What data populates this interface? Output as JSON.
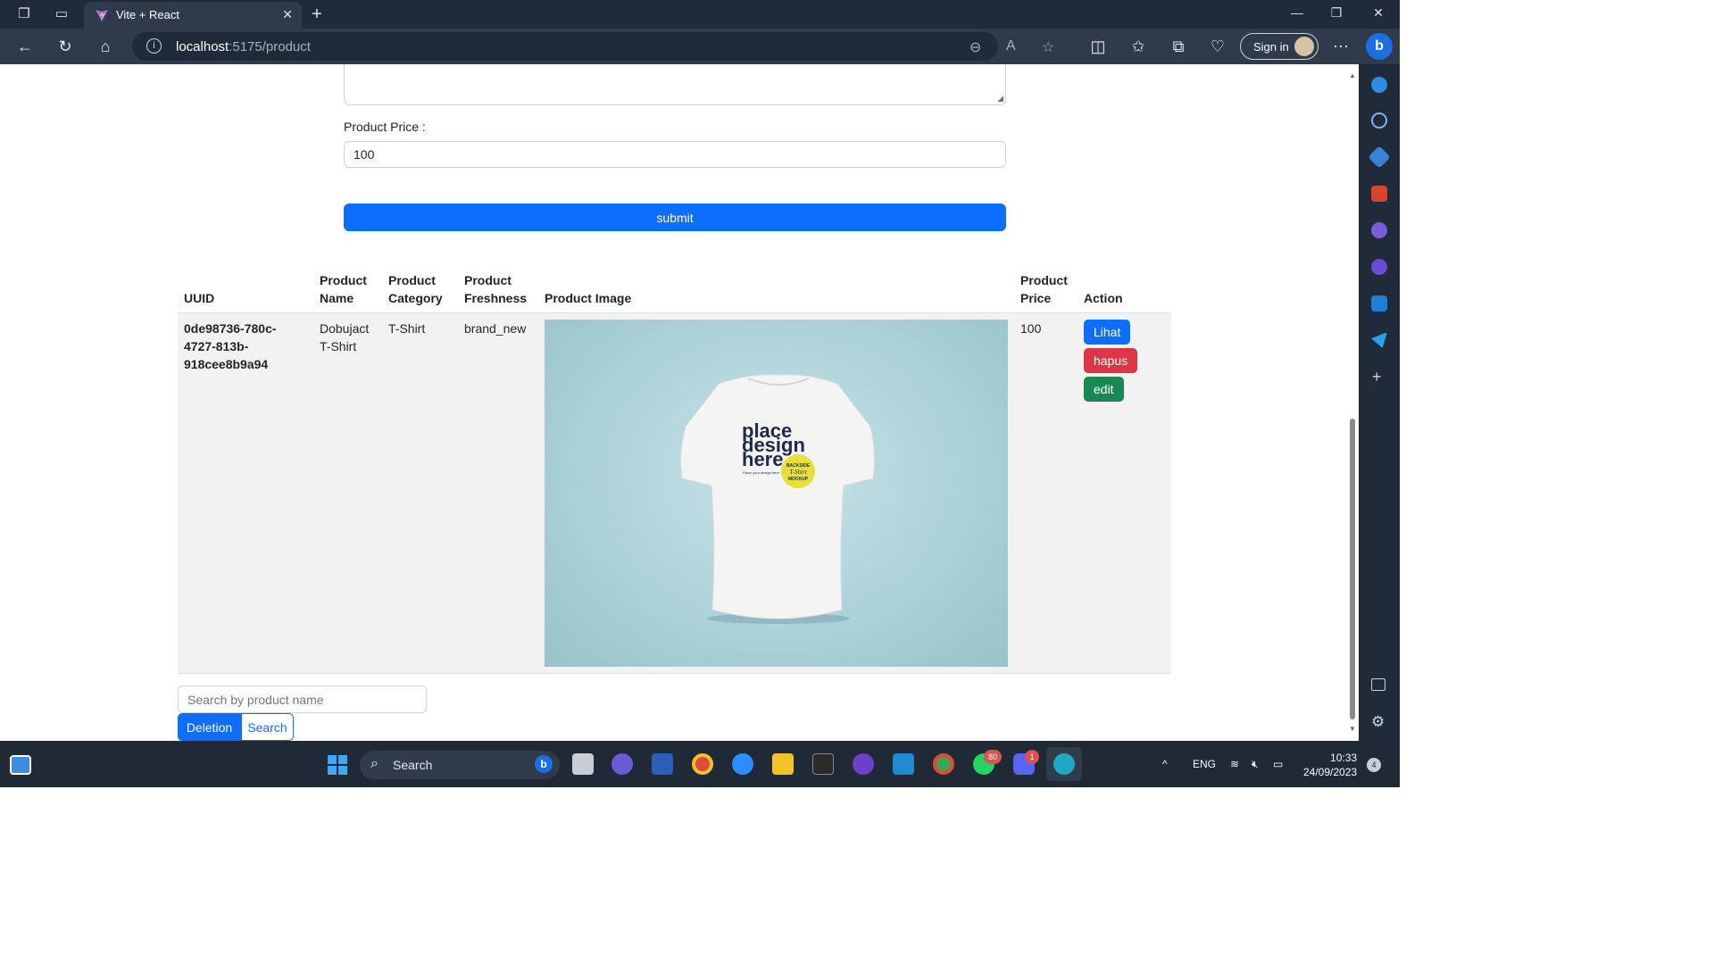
{
  "browser": {
    "tab_title": "Vite + React",
    "url_host": "localhost",
    "url_path": ":5175/product",
    "sign_in": "Sign in"
  },
  "form": {
    "price_label": "Product Price :",
    "price_value": "100",
    "submit_label": "submit"
  },
  "table": {
    "headers": {
      "uuid": "UUID",
      "name": "Product Name",
      "category": "Product Category",
      "freshness": "Product Freshness",
      "image": "Product Image",
      "price": "Product Price",
      "action": "Action"
    },
    "rows": [
      {
        "uuid": "0de98736-780c-4727-813b-918cee8b9a94",
        "name": "Dobujact T-Shirt",
        "category": "T-Shirt",
        "freshness": "brand_new",
        "image_text": "place design here",
        "image_small": "Place your design here",
        "sticker": "BACKSIDE T-Shirt MOCKUP",
        "price": "100",
        "actions": {
          "view": "Lihat",
          "delete": "hapus",
          "edit": "edit"
        }
      }
    ]
  },
  "search": {
    "placeholder": "Search by product name",
    "deletion_label": "Deletion",
    "search_label": "Search"
  },
  "taskbar": {
    "search_label": "Search",
    "language": "ENG",
    "time": "10:33",
    "date": "24/09/2023",
    "whatsapp_badge": "80",
    "discord_badge": "1",
    "notif_count": "4"
  },
  "colors": {
    "primary": "#0d6efd",
    "danger": "#dc3545",
    "success": "#198754",
    "chrome_dark": "#202b3a"
  }
}
